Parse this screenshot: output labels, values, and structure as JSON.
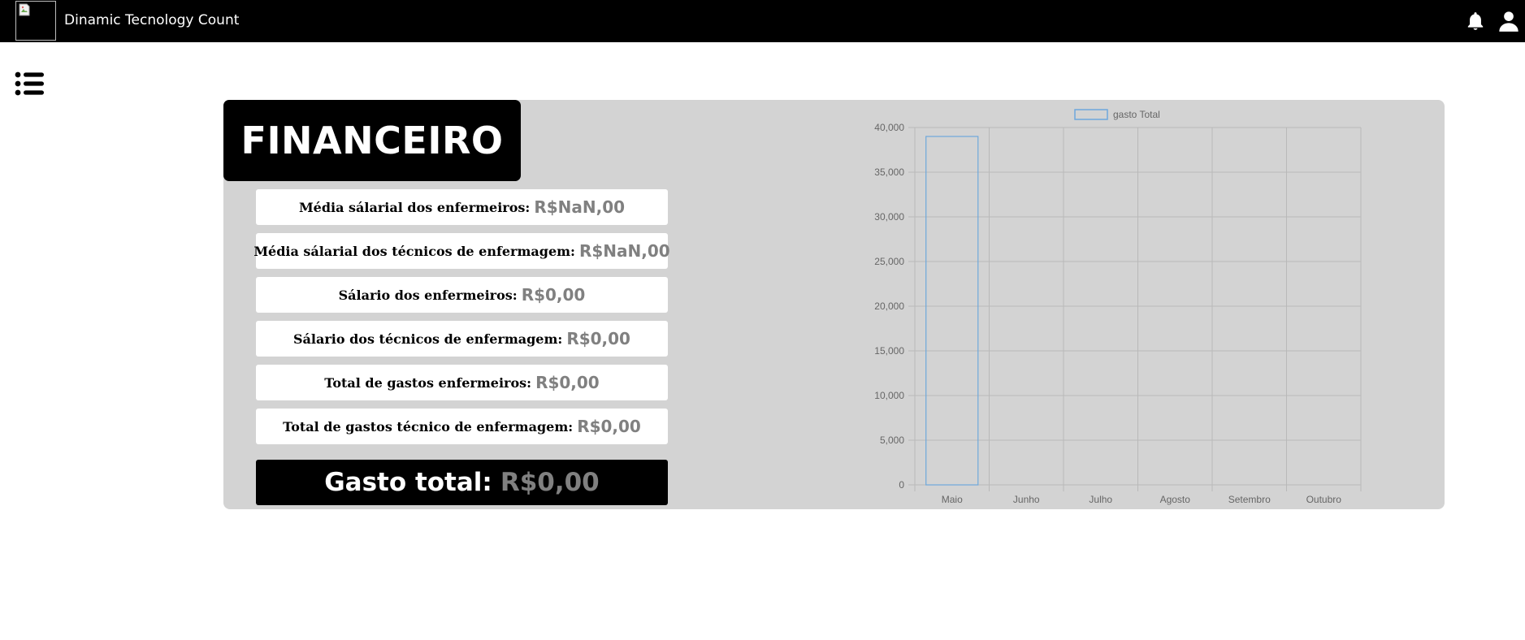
{
  "header": {
    "app_title": "Dinamic Tecnology Count",
    "logo_icon": "broken-image-icon",
    "notification_icon": "bell-icon",
    "profile_icon": "user-icon"
  },
  "sidebar": {
    "toggle_icon": "list-menu-icon"
  },
  "main": {
    "title": "FINANCEIRO",
    "stats": [
      {
        "label": "Média sálarial dos enfermeiros:",
        "value": "R$NaN,00"
      },
      {
        "label": "Média sálarial dos técnicos de enfermagem:",
        "value": "R$NaN,00"
      },
      {
        "label": "Sálario dos enfermeiros:",
        "value": "R$0,00"
      },
      {
        "label": "Sálario dos técnicos de enfermagem:",
        "value": "R$0,00"
      },
      {
        "label": "Total de gastos enfermeiros:",
        "value": "R$0,00"
      },
      {
        "label": "Total de gastos técnico de enfermagem:",
        "value": "R$0,00"
      }
    ],
    "total": {
      "label": "Gasto total:",
      "value": "R$0,00"
    }
  },
  "colors": {
    "header_bg": "#000000",
    "panel_bg": "#d3d3d3",
    "value_text": "#808080",
    "bar_border": "#6ea8dc"
  },
  "chart_data": {
    "type": "bar",
    "categories": [
      "Maio",
      "Junho",
      "Julho",
      "Agosto",
      "Setembro",
      "Outubro"
    ],
    "series": [
      {
        "name": "gasto Total",
        "values": [
          39000,
          0,
          0,
          0,
          0,
          0
        ]
      }
    ],
    "yticks": [
      "0",
      "5,000",
      "10,000",
      "15,000",
      "20,000",
      "25,000",
      "30,000",
      "35,000",
      "40,000"
    ],
    "ylim": [
      0,
      40000
    ],
    "grid": true,
    "legend": "top"
  }
}
